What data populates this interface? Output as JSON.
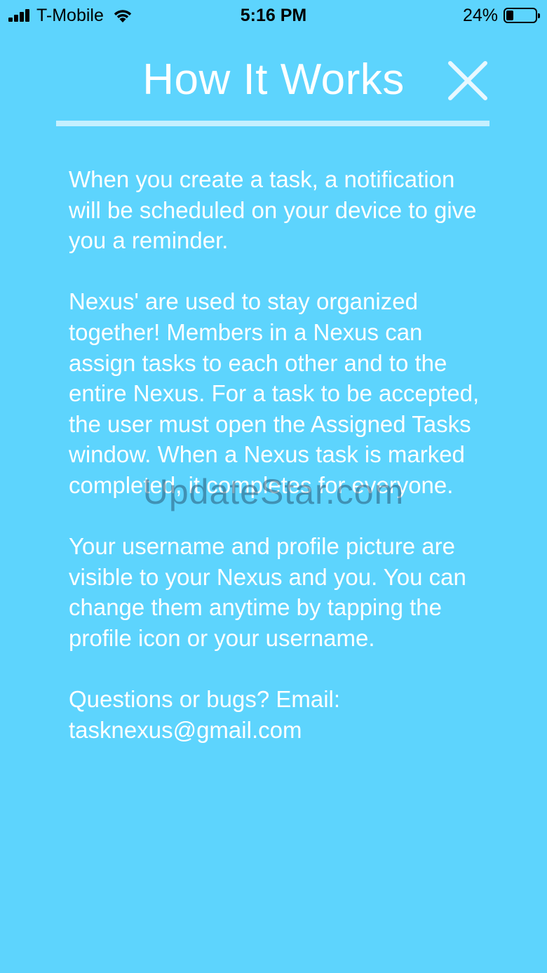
{
  "status_bar": {
    "carrier": "T-Mobile",
    "time": "5:16 PM",
    "battery_percent_text": "24%",
    "battery_level": 0.24,
    "signal_icon": "signal-bars-icon",
    "wifi_icon": "wifi-icon",
    "battery_icon": "battery-icon"
  },
  "header": {
    "title": "How It Works",
    "close_icon": "close-icon"
  },
  "content": {
    "paragraphs": [
      "When you create a task, a notification will be scheduled on your device to give you a reminder.",
      "Nexus' are used to stay organized together! Members in a Nexus can assign tasks to each other and to the entire Nexus. For a task to be accepted, the user must open the Assigned Tasks window. When a Nexus task is marked completed, it completes for everyone.",
      "Your username and profile picture are visible to your Nexus and you. You can change them anytime by tapping the profile icon or your username."
    ],
    "contact_label": "Questions or bugs? Email:",
    "contact_email": "tasknexus@gmail.com"
  },
  "watermark": "UpdateStar.com",
  "colors": {
    "background": "#5dd4fd",
    "text": "#ffffff",
    "divider": "#c5f0ff",
    "close_icon": "#e8f8ff"
  }
}
